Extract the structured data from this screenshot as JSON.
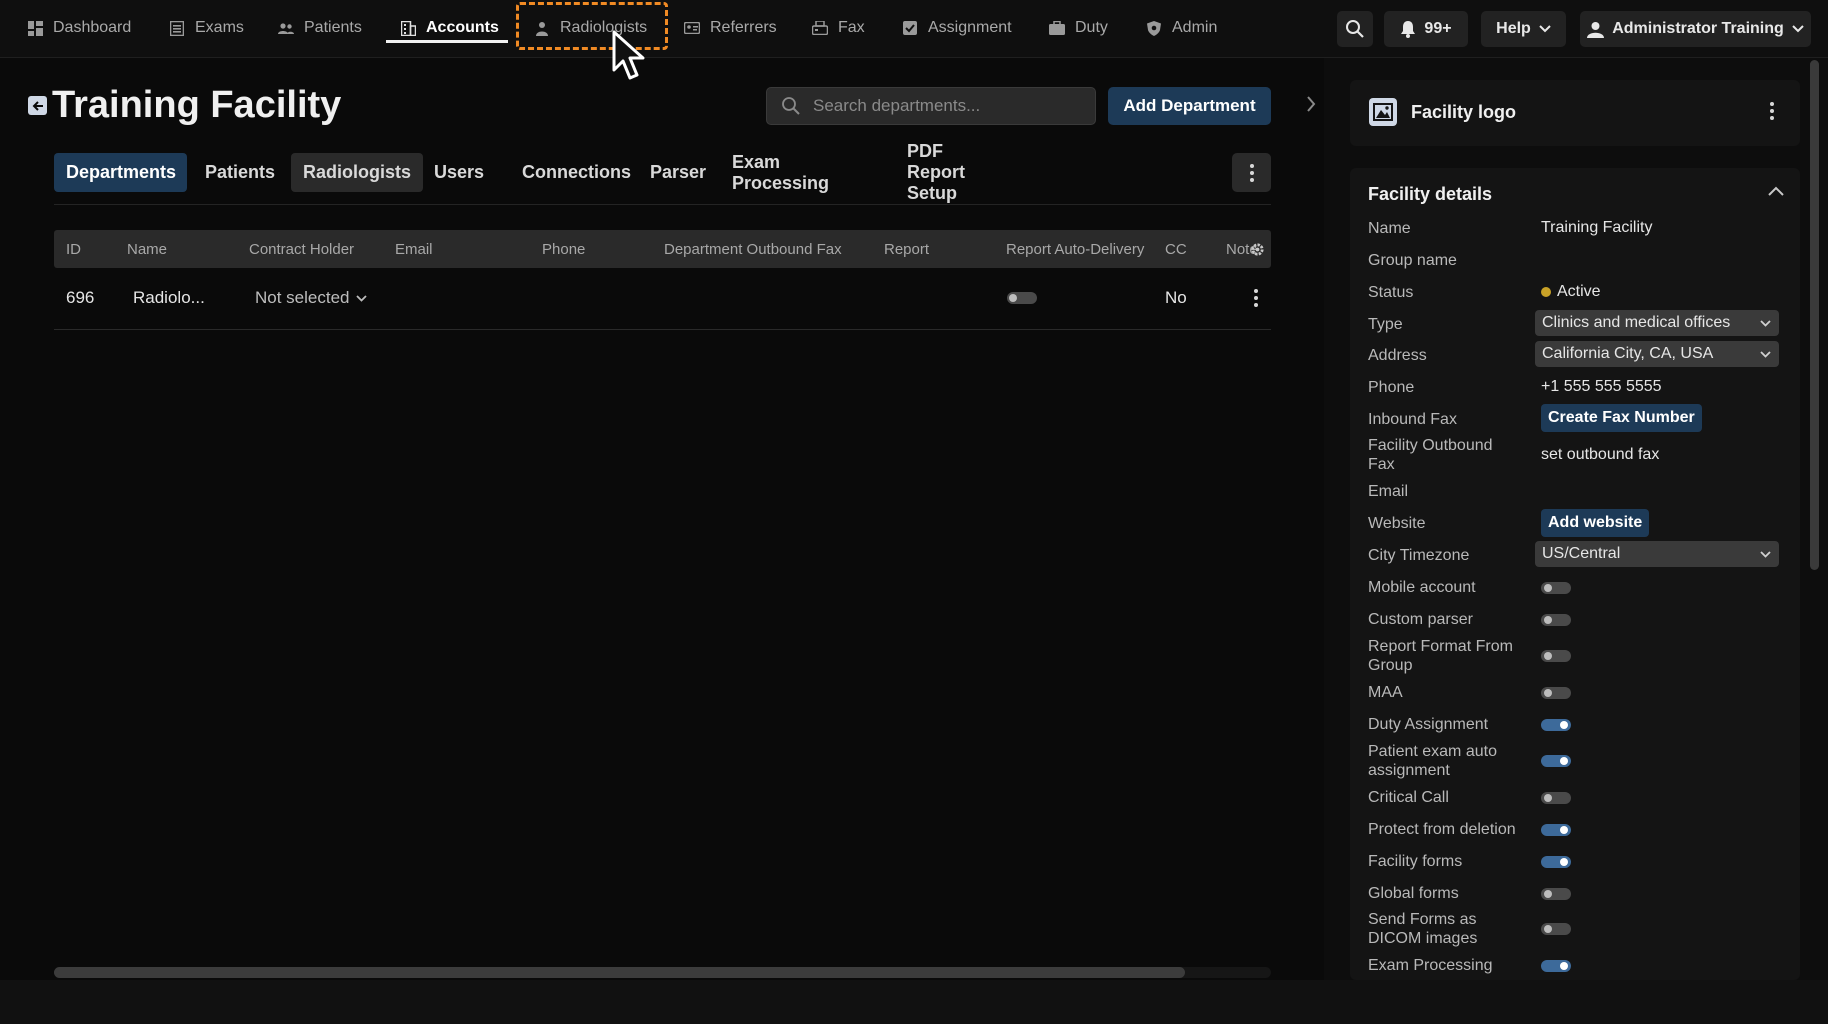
{
  "nav": {
    "items": [
      {
        "label": "Dashboard",
        "icon": "dashboard-icon"
      },
      {
        "label": "Exams",
        "icon": "exams-icon"
      },
      {
        "label": "Patients",
        "icon": "patients-icon"
      },
      {
        "label": "Accounts",
        "icon": "accounts-icon"
      },
      {
        "label": "Radiologists",
        "icon": "radiologists-icon"
      },
      {
        "label": "Referrers",
        "icon": "referrers-icon"
      },
      {
        "label": "Fax",
        "icon": "fax-icon"
      },
      {
        "label": "Assignment",
        "icon": "assignment-icon"
      },
      {
        "label": "Duty",
        "icon": "duty-icon"
      },
      {
        "label": "Admin",
        "icon": "admin-icon"
      }
    ],
    "active": "Accounts",
    "notifications": "99+",
    "help": "Help",
    "user": "Administrator Training"
  },
  "page": {
    "title": "Training Facility",
    "search_placeholder": "Search departments...",
    "add_button": "Add Department"
  },
  "tabs": [
    "Departments",
    "Patients",
    "Radiologists",
    "Users",
    "Connections",
    "Parser",
    "Exam Processing",
    "PDF Report Setup"
  ],
  "table": {
    "columns": [
      "ID",
      "Name",
      "Contract Holder",
      "Email",
      "Phone",
      "Department Outbound Fax",
      "Report",
      "Report Auto-Delivery",
      "CC",
      "Notes"
    ],
    "rows": [
      {
        "id": "696",
        "name": "Radiolo...",
        "contract_holder": "Not selected",
        "email": "",
        "phone": "",
        "outbound_fax": "",
        "report": "",
        "auto_delivery": false,
        "cc": "No"
      }
    ]
  },
  "logo_card": {
    "title": "Facility logo"
  },
  "details": {
    "title": "Facility details",
    "name_label": "Name",
    "name": "Training Facility",
    "group_label": "Group name",
    "status_label": "Status",
    "status": "Active",
    "type_label": "Type",
    "type": "Clinics and medical offices",
    "address_label": "Address",
    "address": "California City, CA, USA",
    "phone_label": "Phone",
    "phone": "+1 555 555 5555",
    "inbound_fax_label": "Inbound Fax",
    "inbound_fax_button": "Create Fax Number",
    "outbound_fax_label": "Facility Outbound Fax",
    "outbound_fax": "set outbound fax",
    "email_label": "Email",
    "website_label": "Website",
    "website_button": "Add website",
    "timezone_label": "City Timezone",
    "timezone": "US/Central",
    "toggles": [
      {
        "label": "Mobile account",
        "on": false
      },
      {
        "label": "Custom parser",
        "on": false
      },
      {
        "label": "Report Format From Group",
        "on": false
      },
      {
        "label": "MAA",
        "on": false
      },
      {
        "label": "Duty Assignment",
        "on": true
      },
      {
        "label": "Patient exam auto assignment",
        "on": true
      },
      {
        "label": "Critical Call",
        "on": false
      },
      {
        "label": "Protect from deletion",
        "on": true
      },
      {
        "label": "Facility forms",
        "on": true
      },
      {
        "label": "Global forms",
        "on": false
      },
      {
        "label": "Send Forms as DICOM images",
        "on": false
      },
      {
        "label": "Exam Processing",
        "on": true
      }
    ]
  },
  "colors": {
    "accent": "#1d3a57",
    "focus_outline": "#f08a24",
    "toggle_on": "#3d6a9a",
    "status_active": "#c9a227"
  }
}
